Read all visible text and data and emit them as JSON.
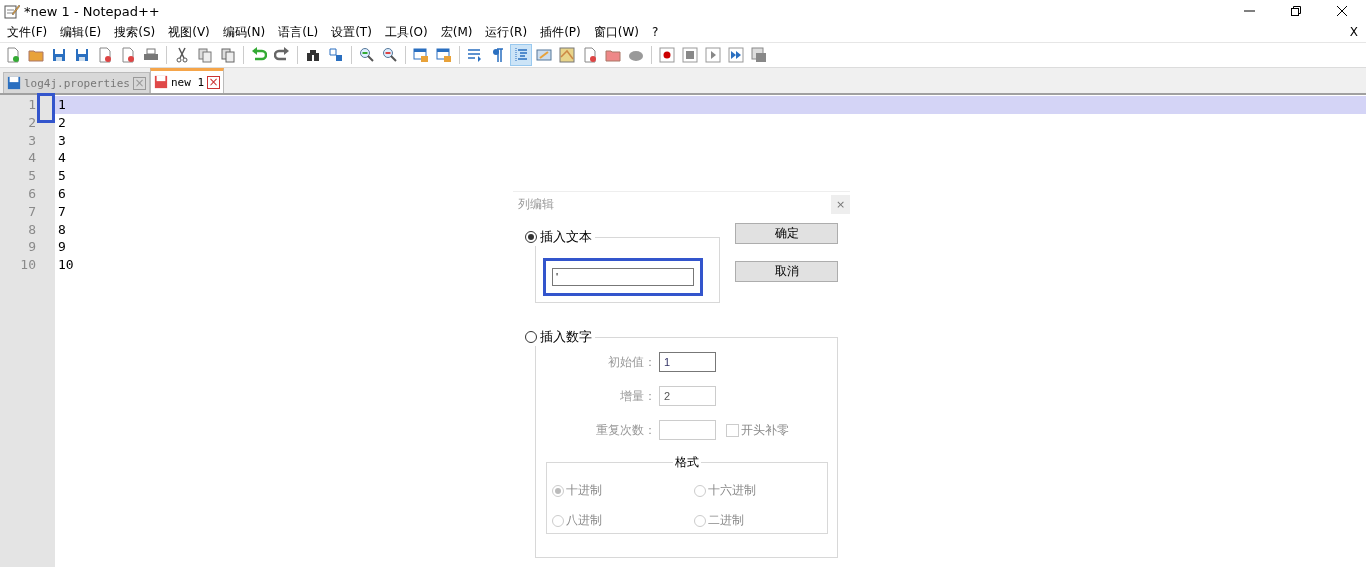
{
  "window": {
    "title": "*new 1 - Notepad++"
  },
  "menu": [
    "文件(F)",
    "编辑(E)",
    "搜索(S)",
    "视图(V)",
    "编码(N)",
    "语言(L)",
    "设置(T)",
    "工具(O)",
    "宏(M)",
    "运行(R)",
    "插件(P)",
    "窗口(W)",
    "?"
  ],
  "menu_close": "X",
  "tabs": [
    {
      "label": "log4j.properties",
      "selected": false,
      "modified": false,
      "close": "×"
    },
    {
      "label": "new 1",
      "selected": true,
      "modified": true,
      "close": "×"
    }
  ],
  "lines": [
    {
      "number": "1",
      "text": "1",
      "current": true
    },
    {
      "number": "2",
      "text": "2",
      "current": false
    },
    {
      "number": "3",
      "text": "3",
      "current": false
    },
    {
      "number": "4",
      "text": "4",
      "current": false
    },
    {
      "number": "5",
      "text": "5",
      "current": false
    },
    {
      "number": "6",
      "text": "6",
      "current": false
    },
    {
      "number": "7",
      "text": "7",
      "current": false
    },
    {
      "number": "8",
      "text": "8",
      "current": false
    },
    {
      "number": "9",
      "text": "9",
      "current": false
    },
    {
      "number": "10",
      "text": "10",
      "current": false
    }
  ],
  "dialog": {
    "title": "列编辑",
    "close": "×",
    "insert_text": {
      "label": "插入文本",
      "selected": true,
      "value": "'"
    },
    "buttons": [
      "确定",
      "取消"
    ],
    "insert_number": {
      "label": "插入数字",
      "selected": false,
      "fields": [
        {
          "label": "初始值：",
          "value": "1",
          "disabled": false
        },
        {
          "label": "增量：",
          "value": "2",
          "disabled": true
        },
        {
          "label": "重复次数：",
          "disabled": true
        }
      ],
      "leading_zeros": {
        "label": "开头补零",
        "checked": false
      },
      "format": {
        "title": "格式",
        "options": [
          {
            "label": "十进制",
            "selected": true
          },
          {
            "label": "十六进制",
            "selected": false
          },
          {
            "label": "八进制",
            "selected": false
          },
          {
            "label": "二进制",
            "selected": false
          }
        ]
      }
    }
  }
}
